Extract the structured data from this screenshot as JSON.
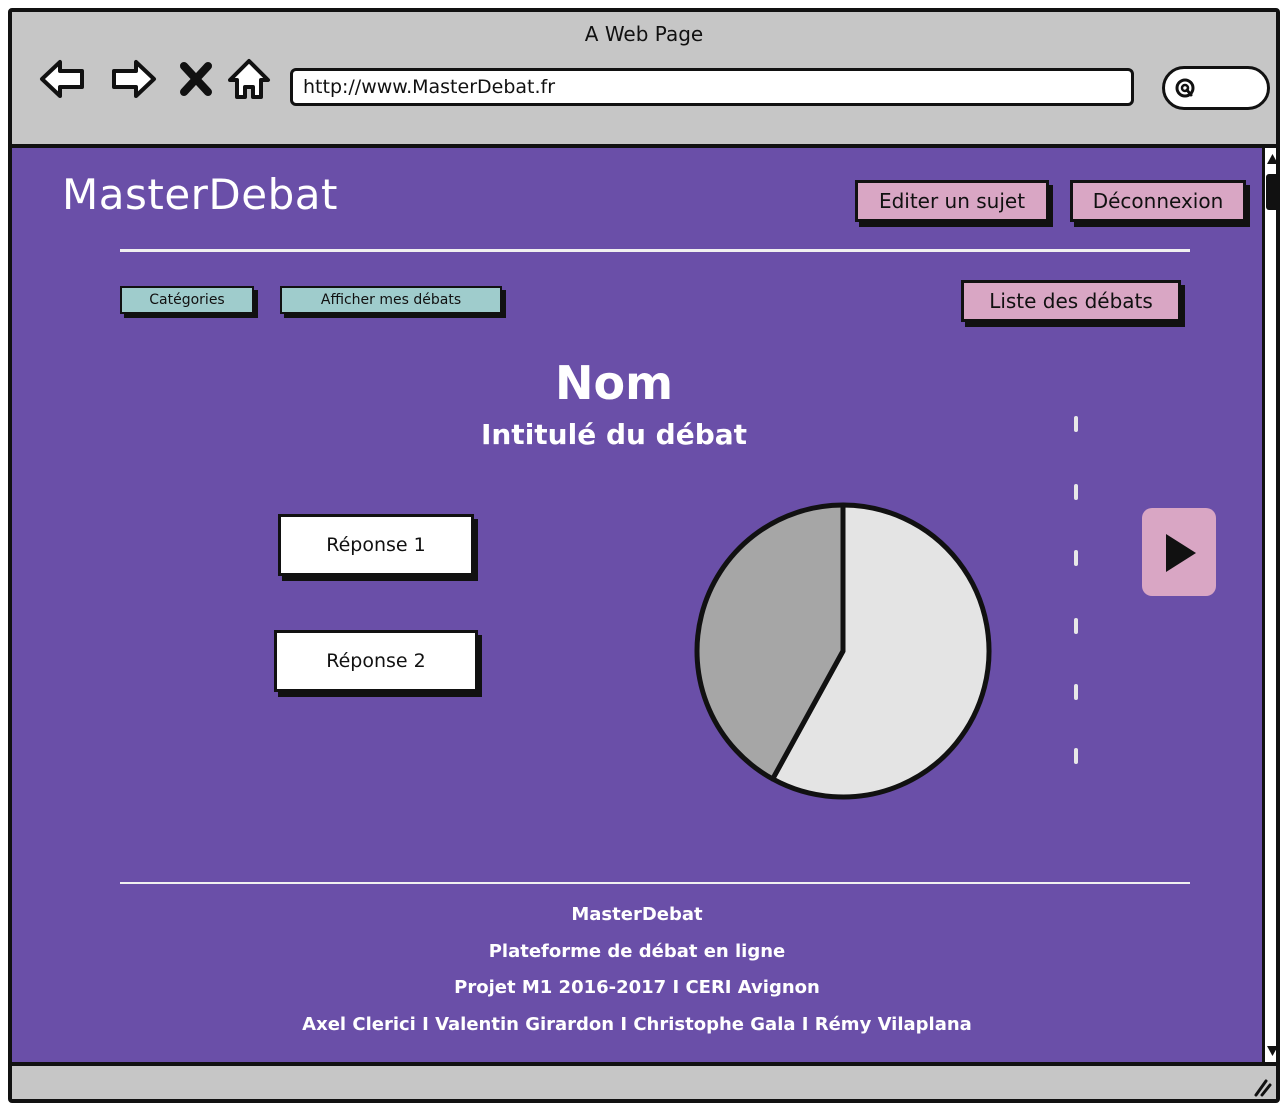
{
  "browser": {
    "window_title": "A Web Page",
    "url": "http://www.MasterDebat.fr"
  },
  "header": {
    "logo": "MasterDebat",
    "edit_subject_label": "Editer un sujet",
    "logout_label": "Déconnexion"
  },
  "toolbar": {
    "categories_label": "Catégories",
    "my_debates_label": "Afficher mes débats",
    "debate_list_label": "Liste des débats"
  },
  "debate": {
    "name": "Nom",
    "title": "Intitulé du débat",
    "answers": [
      {
        "label": "Réponse 1"
      },
      {
        "label": "Réponse 2"
      }
    ]
  },
  "chart_data": {
    "type": "pie",
    "title": "",
    "series": [
      {
        "values": [
          58,
          42
        ],
        "colors": [
          "#e4e4e4",
          "#a6a6a6"
        ]
      }
    ]
  },
  "footer": {
    "lines": [
      "MasterDebat",
      "Plateforme de débat en ligne",
      "Projet M1 2016-2017 I CERI Avignon",
      "Axel Clerici I Valentin Girardon I Christophe Gala I Rémy Vilaplana"
    ]
  },
  "colors": {
    "page_background": "#6a4fa8",
    "pink_button": "#d9a6c4",
    "teal_button": "#9fcccc",
    "chrome": "#c6c6c6"
  },
  "icons": {
    "back": "arrow-left-icon",
    "forward": "arrow-right-icon",
    "stop": "close-icon",
    "home": "home-icon",
    "search": "search-icon",
    "next": "play-icon"
  }
}
